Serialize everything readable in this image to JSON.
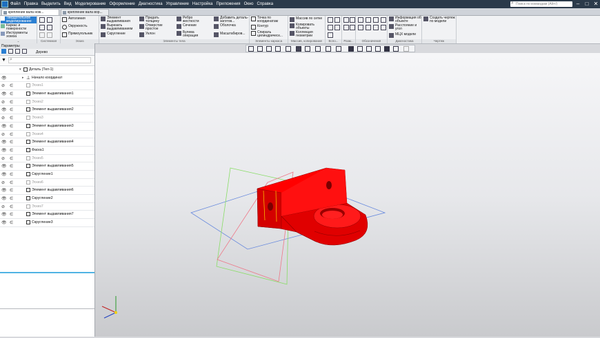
{
  "titlebar": {
    "menu": [
      "Файл",
      "Правка",
      "Выделить",
      "Вид",
      "Моделирование",
      "Оформление",
      "Диагностика",
      "Управление",
      "Настройка",
      "Приложения",
      "Окно",
      "Справка"
    ],
    "search_placeholder": "Поиск по командам (Alt+/)"
  },
  "tabs": [
    {
      "label": "крепление вала нож..."
    },
    {
      "label": "крепление вала вор..."
    }
  ],
  "ribbon": {
    "modes": [
      "Твердотельное моделирование",
      "Каркас и поверхности",
      "Инструменты эскиза"
    ],
    "groups": {
      "sketch": "Системная",
      "eskiz": "Эскиз",
      "body": "Элементы тела",
      "frame": "Элементы каркаса",
      "array": "Массив, копирование",
      "aux": "Вспо...",
      "mark": "Разм...",
      "desig": "Обозначения",
      "diag": "Диагностика",
      "drawing": "Чертеж"
    },
    "eskiz_items": [
      "Автолиния",
      "Окружность",
      "Прямоугольник"
    ],
    "body_items_1": [
      "Элемент выдавливания",
      "Вырезать выдавливанием",
      "Скругление"
    ],
    "body_items_2": [
      "Придать толщину",
      "Отверстие простое",
      "Уклон"
    ],
    "body_items_3": [
      "Ребро жесткости",
      "Сечение",
      "Булева операция"
    ],
    "body_items_4": [
      "Добавить деталь-заготов...",
      "Оболочка",
      "Масштабиров..."
    ],
    "frame_items": [
      "Точка по координатам",
      "Контур",
      "Спираль цилиндрическ..."
    ],
    "array_items": [
      "Массив по сетке",
      "Копировать объекты",
      "Коллекция геометрии"
    ],
    "diag_items": [
      "Информация об объекте",
      "Расстояние и угол",
      "МЦХ модели"
    ],
    "drawing_item": "Создать чертеж по модели"
  },
  "panel": {
    "header": "Параметры",
    "tab_tree": "Дерево",
    "search_placeholder": "",
    "root": "Деталь (Тел-1)",
    "origin": "Начало координат",
    "nodes": [
      {
        "label": "Эскиз1",
        "kind": "sketch",
        "hidden": true
      },
      {
        "label": "Элемент выдавливания1",
        "kind": "extrude",
        "hidden": false
      },
      {
        "label": "Эскиз2",
        "kind": "sketch",
        "hidden": true
      },
      {
        "label": "Элемент выдавливания2",
        "kind": "extrude",
        "hidden": false
      },
      {
        "label": "Эскиз3",
        "kind": "sketch",
        "hidden": true
      },
      {
        "label": "Элемент выдавливания3",
        "kind": "extrude",
        "hidden": false
      },
      {
        "label": "Эскиз4",
        "kind": "sketch",
        "hidden": true
      },
      {
        "label": "Элемент выдавливания4",
        "kind": "extrude",
        "hidden": false
      },
      {
        "label": "Фаска1",
        "kind": "chamfer",
        "hidden": false
      },
      {
        "label": "Эскиз5",
        "kind": "sketch",
        "hidden": true
      },
      {
        "label": "Элемент выдавливания5",
        "kind": "extrude",
        "hidden": false
      },
      {
        "label": "Скругление1",
        "kind": "fillet",
        "hidden": false
      },
      {
        "label": "Эскиз6",
        "kind": "sketch",
        "hidden": true
      },
      {
        "label": "Элемент выдавливания6",
        "kind": "extrude",
        "hidden": false
      },
      {
        "label": "Скругление2",
        "kind": "fillet",
        "hidden": false
      },
      {
        "label": "Эскиз7",
        "kind": "sketch",
        "hidden": true
      },
      {
        "label": "Элемент выдавливания7",
        "kind": "extrude",
        "hidden": false
      },
      {
        "label": "Скругление3",
        "kind": "fillet",
        "hidden": false
      }
    ]
  },
  "colors": {
    "part": "#ff0000",
    "accent": "#2b7fd2",
    "titlebar": "#2b3a4a",
    "tree_end_line": "#4fb3e3"
  }
}
